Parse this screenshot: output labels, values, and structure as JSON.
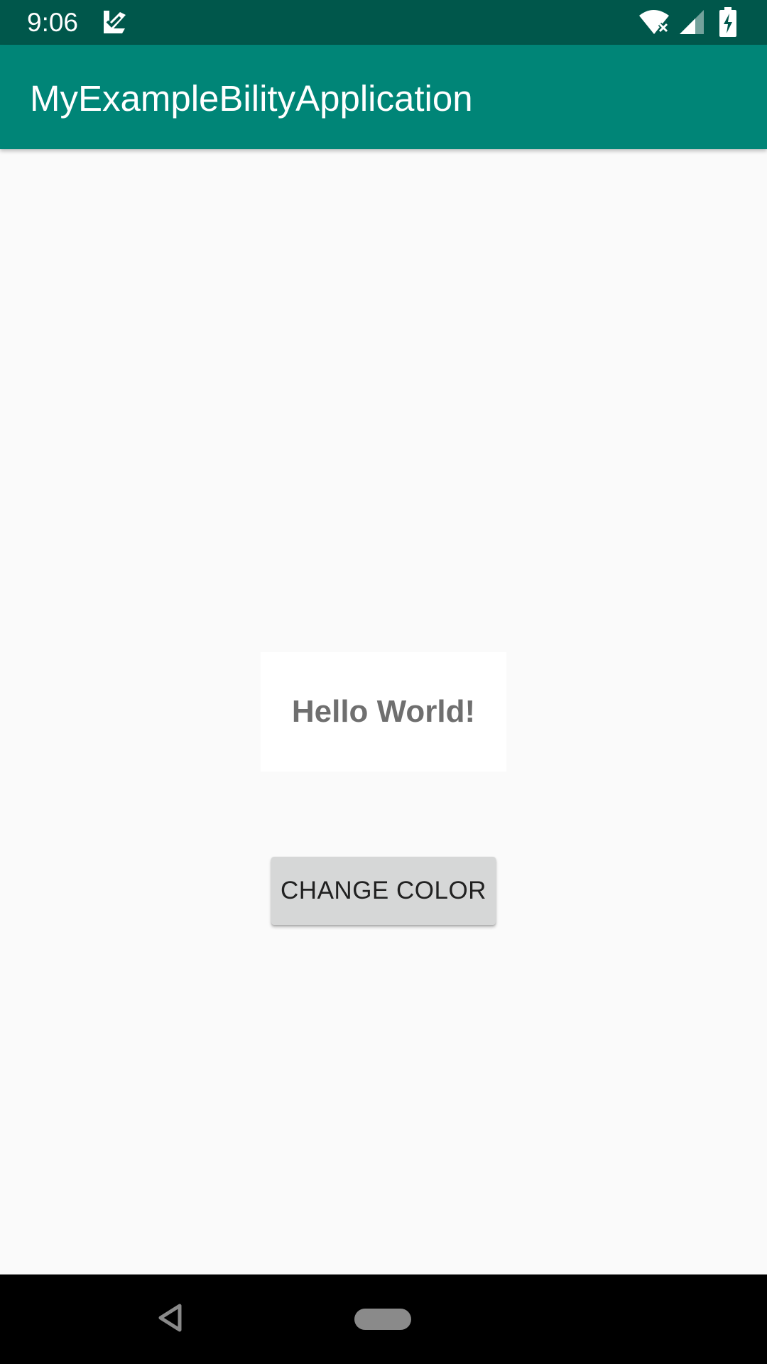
{
  "status_bar": {
    "time": "9:06",
    "icons": [
      "notification-check-icon",
      "wifi-icon",
      "signal-icon",
      "battery-charging-icon"
    ]
  },
  "app_bar": {
    "title": "MyExampleBilityApplication"
  },
  "main": {
    "hello_text": "Hello World!",
    "button_label": "CHANGE COLOR"
  },
  "nav_bar": {
    "icons": [
      "back-icon",
      "home-icon"
    ]
  },
  "colors": {
    "status_bar": "#00574b",
    "app_bar": "#008577",
    "background": "#fafafa",
    "button": "#d6d7d7",
    "hello_text": "#6f6f6f"
  }
}
